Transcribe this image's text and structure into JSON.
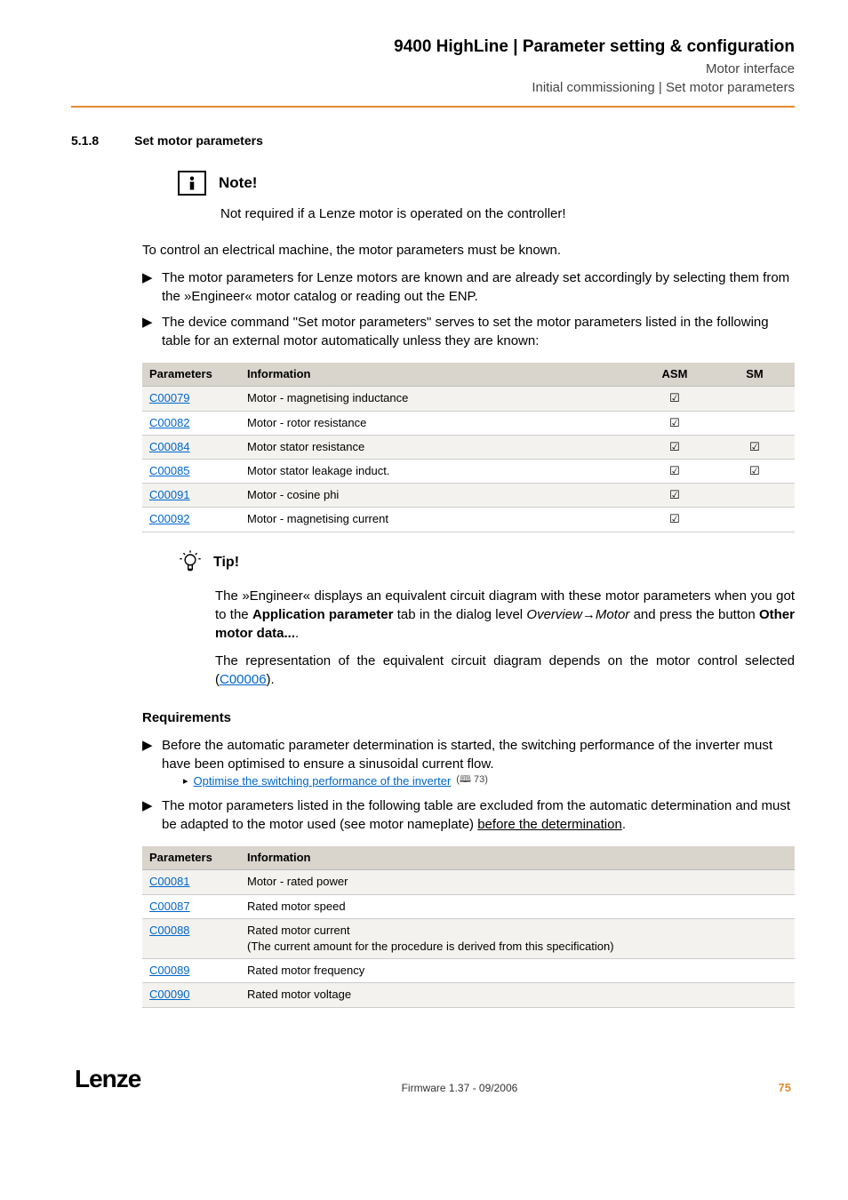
{
  "header": {
    "title": "9400 HighLine | Parameter setting & configuration",
    "sub1": "Motor interface",
    "sub2": "Initial commissioning | Set motor parameters"
  },
  "section": {
    "num": "5.1.8",
    "title": "Set motor parameters"
  },
  "note": {
    "label": "Note!",
    "text": "Not required if a Lenze motor is operated on the controller!"
  },
  "intro": "To control an electrical machine, the motor parameters must be known.",
  "bullets1": [
    "The motor parameters for Lenze motors are known and are already set accordingly by selecting them from the »Engineer« motor catalog or reading out the ENP.",
    "The device command \"Set motor parameters\" serves to set the motor parameters listed in the following table for an external motor automatically unless they are known:"
  ],
  "table1": {
    "headers": [
      "Parameters",
      "Information",
      "ASM",
      "SM"
    ],
    "rows": [
      {
        "param": "C00079",
        "info": "Motor - magnetising inductance",
        "asm": "☑",
        "sm": ""
      },
      {
        "param": "C00082",
        "info": "Motor - rotor resistance",
        "asm": "☑",
        "sm": ""
      },
      {
        "param": "C00084",
        "info": "Motor stator resistance",
        "asm": "☑",
        "sm": "☑"
      },
      {
        "param": "C00085",
        "info": "Motor stator leakage induct.",
        "asm": "☑",
        "sm": "☑"
      },
      {
        "param": "C00091",
        "info": "Motor - cosine phi",
        "asm": "☑",
        "sm": ""
      },
      {
        "param": "C00092",
        "info": "Motor - magnetising current",
        "asm": "☑",
        "sm": ""
      }
    ]
  },
  "tip": {
    "label": "Tip!",
    "p1_pre": "The »Engineer« displays an equivalent circuit diagram with these motor parameters when you got to the ",
    "p1_b1": "Application parameter",
    "p1_mid": " tab in the dialog level ",
    "p1_i": "Overview→Motor",
    "p1_mid2": " and press the button ",
    "p1_b2": "Other motor data...",
    "p1_end": ".",
    "p2_pre": "The representation of the equivalent circuit diagram depends on the motor control selected (",
    "p2_link": "C00006",
    "p2_end": ")."
  },
  "requirements": {
    "heading": "Requirements",
    "b1": "Before the automatic parameter determination is started, the switching performance of the inverter must have been optimised to ensure a sinusoidal current flow.",
    "b1_link": "Optimise the switching performance of the inverter",
    "b1_ref": "(🕮 73)",
    "b2_pre": "The motor parameters listed in the following table are excluded from the automatic determination and must be adapted to the motor used (see motor nameplate) ",
    "b2_u": "before the determination",
    "b2_end": "."
  },
  "table2": {
    "headers": [
      "Parameters",
      "Information"
    ],
    "rows": [
      {
        "param": "C00081",
        "info": "Motor - rated power"
      },
      {
        "param": "C00087",
        "info": "Rated motor speed"
      },
      {
        "param": "C00088",
        "info": "Rated motor current\n(The current amount for the procedure is derived from this specification)"
      },
      {
        "param": "C00089",
        "info": "Rated motor frequency"
      },
      {
        "param": "C00090",
        "info": "Rated motor voltage"
      }
    ]
  },
  "footer": {
    "logo": "Lenze",
    "center": "Firmware 1.37 - 09/2006",
    "page": "75"
  }
}
